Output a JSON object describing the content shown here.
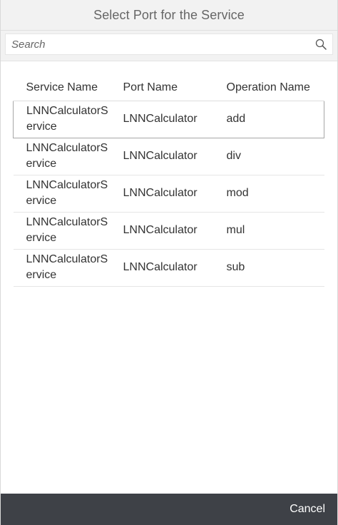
{
  "dialog": {
    "title": "Select Port for the Service"
  },
  "search": {
    "placeholder": "Search",
    "value": "",
    "icon": "search-icon"
  },
  "table": {
    "columns": [
      "Service Name",
      "Port Name",
      "Operation Name"
    ],
    "rows": [
      {
        "service": "LNNCalculatorService",
        "port": "LNNCalculator",
        "operation": "add"
      },
      {
        "service": "LNNCalculatorService",
        "port": "LNNCalculator",
        "operation": "div"
      },
      {
        "service": "LNNCalculatorService",
        "port": "LNNCalculator",
        "operation": "mod"
      },
      {
        "service": "LNNCalculatorService",
        "port": "LNNCalculator",
        "operation": "mul"
      },
      {
        "service": "LNNCalculatorService",
        "port": "LNNCalculator",
        "operation": "sub"
      }
    ]
  },
  "footer": {
    "cancel_label": "Cancel"
  },
  "colors": {
    "footer_bg": "#3e4147",
    "header_bg": "#f2f2f2",
    "text": "#333333"
  }
}
